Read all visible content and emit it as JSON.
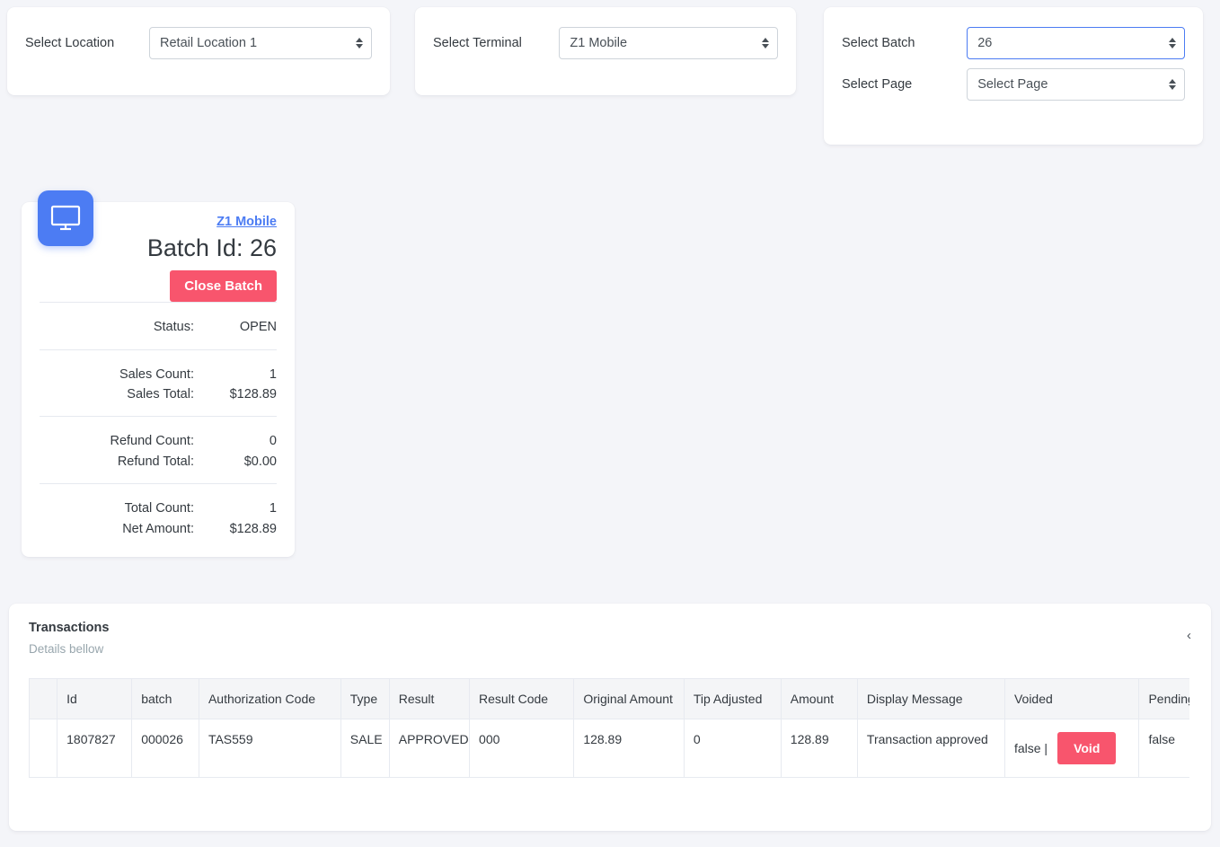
{
  "selectors": {
    "location": {
      "label": "Select Location",
      "value": "Retail Location 1"
    },
    "terminal": {
      "label": "Select Terminal",
      "value": "Z1 Mobile"
    },
    "batch": {
      "label": "Select Batch",
      "value": "26"
    },
    "page": {
      "label": "Select Page",
      "value": "Select Page"
    }
  },
  "batch_card": {
    "icon": "monitor-icon",
    "terminal_link": "Z1 Mobile",
    "title": "Batch Id: 26",
    "close_button": "Close Batch",
    "stats": [
      [
        {
          "key": "Status:",
          "value": "OPEN"
        }
      ],
      [
        {
          "key": "Sales Count:",
          "value": "1"
        },
        {
          "key": "Sales Total:",
          "value": "$128.89"
        }
      ],
      [
        {
          "key": "Refund Count:",
          "value": "0"
        },
        {
          "key": "Refund Total:",
          "value": "$0.00"
        }
      ],
      [
        {
          "key": "Total Count:",
          "value": "1"
        },
        {
          "key": "Net Amount:",
          "value": "$128.89"
        }
      ]
    ]
  },
  "transactions": {
    "title": "Transactions",
    "subtitle": "Details bellow",
    "collapse_icon": "‹",
    "columns": [
      "",
      "Id",
      "batch",
      "Authorization Code",
      "Type",
      "Result",
      "Result Code",
      "Original Amount",
      "Tip Adjusted",
      "Amount",
      "Display Message",
      "Voided",
      "Pending"
    ],
    "rows": [
      {
        "spacer": "",
        "id": "1807827",
        "batch": "000026",
        "authorization_code": "TAS559",
        "type": "SALE",
        "result": "APPROVED",
        "result_code": "000",
        "original_amount": "128.89",
        "tip_adjusted": "0",
        "amount": "128.89",
        "display_message": "Transaction approved",
        "voided_flag": "false |",
        "void_button": "Void",
        "pending": "false"
      }
    ]
  },
  "colors": {
    "accent_blue": "#4c7cf3",
    "danger": "#f8556d",
    "page_bg": "#f4f5f9",
    "header_bg": "#f4f5f7",
    "muted": "#98a6ad"
  }
}
